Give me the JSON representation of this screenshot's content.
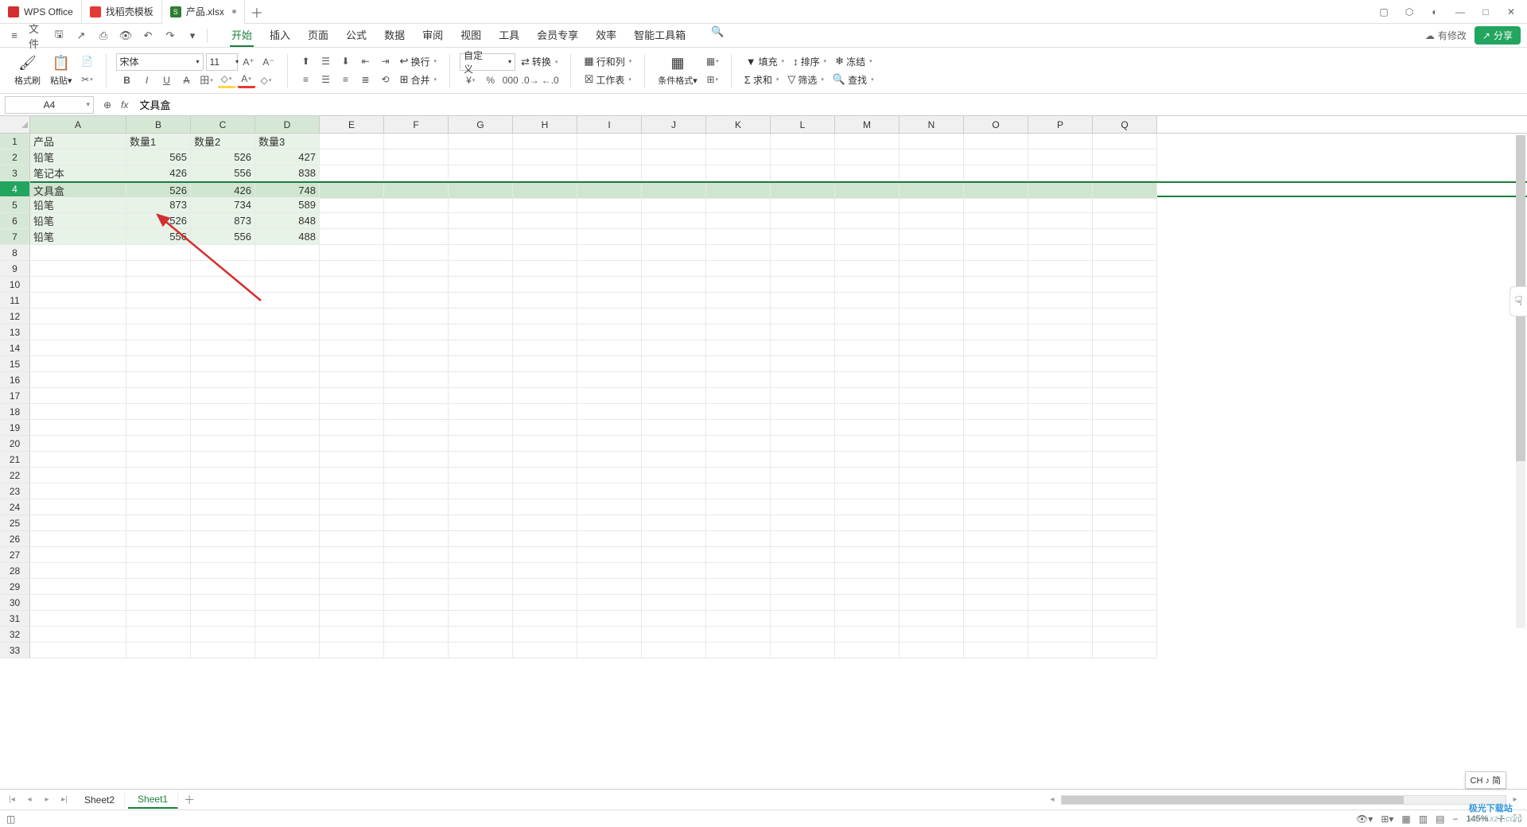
{
  "titlebar": {
    "tabs": [
      {
        "label": "WPS Office",
        "icon": "wps"
      },
      {
        "label": "找稻壳模板",
        "icon": "tmpl"
      },
      {
        "label": "产品.xlsx",
        "icon": "xls",
        "active": true,
        "dirty": true
      }
    ]
  },
  "menu": {
    "file": "文件",
    "tabs": [
      "开始",
      "插入",
      "页面",
      "公式",
      "数据",
      "审阅",
      "视图",
      "工具",
      "会员专享",
      "效率",
      "智能工具箱"
    ],
    "active_tab": "开始",
    "cloud_status": "有修改",
    "share": "分享"
  },
  "ribbon": {
    "format_painter": "格式刷",
    "paste": "粘贴",
    "font_name": "宋体",
    "font_size": "11",
    "wrap": "换行",
    "merge": "合并",
    "number_format": "自定义",
    "convert": "转换",
    "rowcol": "行和列",
    "worksheet": "工作表",
    "cond_fmt": "条件格式",
    "fill": "填充",
    "sort": "排序",
    "freeze": "冻结",
    "sum": "求和",
    "filter": "筛选",
    "find": "查找"
  },
  "formula": {
    "cell_ref": "A4",
    "content": "文具盒"
  },
  "sheet": {
    "columns": [
      "A",
      "B",
      "C",
      "D",
      "E",
      "F",
      "G",
      "H",
      "I",
      "J",
      "K",
      "L",
      "M",
      "N",
      "O",
      "P",
      "Q"
    ],
    "selected_cols": [
      "A",
      "B",
      "C",
      "D"
    ],
    "active_row": 4,
    "highlighted_rows": [
      1,
      2,
      3,
      5,
      6,
      7
    ],
    "row_count": 33,
    "headers": [
      "产品",
      "数量1",
      "数量2",
      "数量3"
    ],
    "rows": [
      {
        "a": "铅笔",
        "b": 565,
        "c": 526,
        "d": 427
      },
      {
        "a": "笔记本",
        "b": 426,
        "c": 556,
        "d": 838
      },
      {
        "a": "文具盒",
        "b": 526,
        "c": 426,
        "d": 748
      },
      {
        "a": "铅笔",
        "b": 873,
        "c": 734,
        "d": 589
      },
      {
        "a": "铅笔",
        "b": 526,
        "c": 873,
        "d": 848
      },
      {
        "a": "铅笔",
        "b": 556,
        "c": 556,
        "d": 488
      }
    ]
  },
  "sheet_tabs": {
    "tabs": [
      "Sheet2",
      "Sheet1"
    ],
    "active": "Sheet1"
  },
  "status": {
    "ime": "CH ♪ 简",
    "zoom": "145%",
    "watermark_brand": "极光下载站",
    "watermark_url": "www.xz7.com"
  }
}
